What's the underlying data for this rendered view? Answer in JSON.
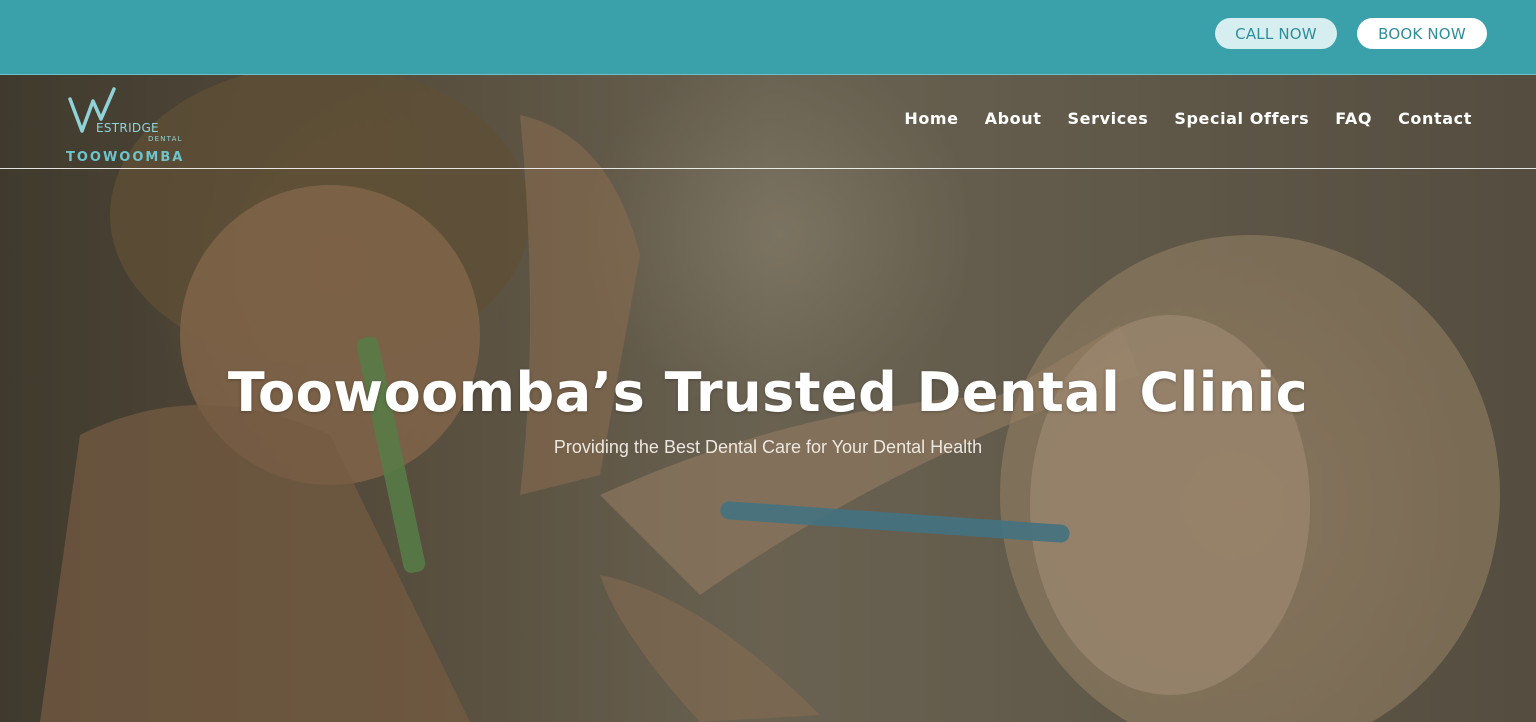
{
  "topbar": {
    "call_label": "CALL NOW",
    "book_label": "BOOK NOW"
  },
  "logo": {
    "word": "ESTRIDGE",
    "sub": "DENTAL",
    "city": "TOOWOOMBA",
    "icon": "w-logo-icon"
  },
  "nav": {
    "items": [
      {
        "label": "Home"
      },
      {
        "label": "About"
      },
      {
        "label": "Services"
      },
      {
        "label": "Special Offers"
      },
      {
        "label": "FAQ"
      },
      {
        "label": "Contact"
      }
    ]
  },
  "hero": {
    "title": "Toowoomba’s Trusted Dental Clinic",
    "subtitle": "Providing the Best Dental Care for Your Dental Health"
  },
  "colors": {
    "brand_teal": "#3aa0aa",
    "button_text": "#2f8e98",
    "logo_teal": "#8fd3d8"
  }
}
